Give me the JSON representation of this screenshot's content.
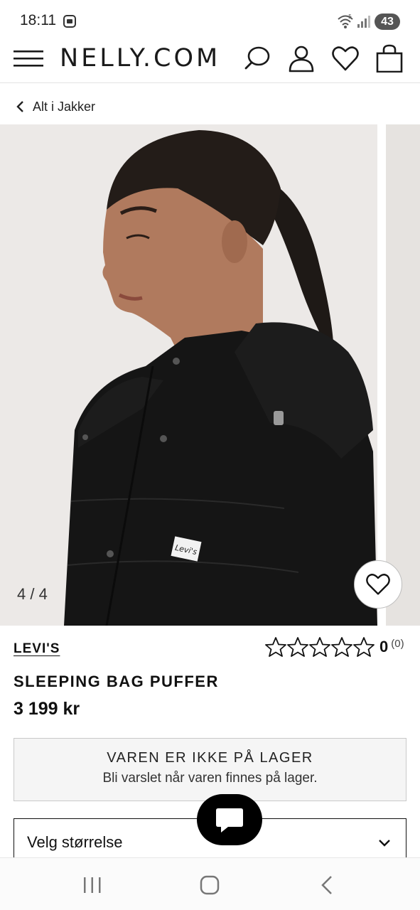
{
  "status_bar": {
    "time": "18:11",
    "battery": "43",
    "wifi_label": "5"
  },
  "header": {
    "logo": "NELLY.COM"
  },
  "breadcrumb": {
    "label": "Alt i Jakker"
  },
  "gallery": {
    "counter": "4 / 4"
  },
  "product": {
    "brand": "LEVI'S",
    "name": "SLEEPING BAG PUFFER",
    "price": "3 199 kr",
    "rating_value": "0",
    "rating_count": "(0)",
    "stars": 0,
    "logo_patch": "Levi's"
  },
  "stock": {
    "title": "VAREN ER IKKE PÅ LAGER",
    "subtitle": "Bli varslet når varen finnes på lager."
  },
  "size": {
    "label": "Velg størrelse"
  },
  "colors": {
    "accent": "#000000",
    "text": "#111111"
  }
}
